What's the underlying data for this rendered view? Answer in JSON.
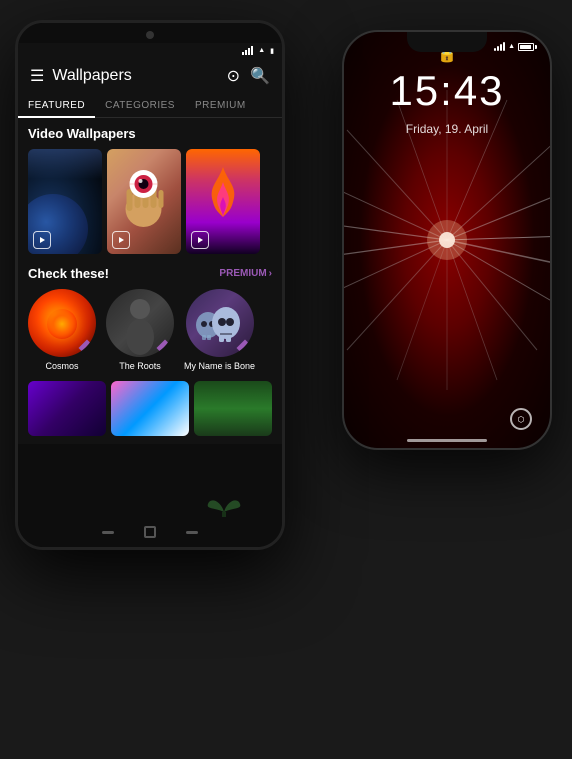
{
  "android": {
    "title": "Wallpapers",
    "tabs": [
      {
        "id": "featured",
        "label": "FEATURED",
        "active": true
      },
      {
        "id": "categories",
        "label": "CATEGORIES",
        "active": false
      },
      {
        "id": "premium",
        "label": "PREMIUM",
        "active": false
      }
    ],
    "sections": {
      "video_wallpapers": {
        "title": "Video Wallpapers",
        "items": [
          {
            "id": "earth",
            "type": "video"
          },
          {
            "id": "eye",
            "type": "video"
          },
          {
            "id": "flame",
            "type": "video"
          }
        ]
      },
      "check_these": {
        "title": "Check these!",
        "premium_label": "PREMIUM",
        "items": [
          {
            "id": "cosmos",
            "label": "Cosmos"
          },
          {
            "id": "roots",
            "label": "The Roots"
          },
          {
            "id": "bone",
            "label": "My Name is Bone"
          }
        ]
      }
    }
  },
  "iphone": {
    "time": "15:43",
    "date": "Friday, 19. April",
    "lock_icon": "🔒"
  }
}
